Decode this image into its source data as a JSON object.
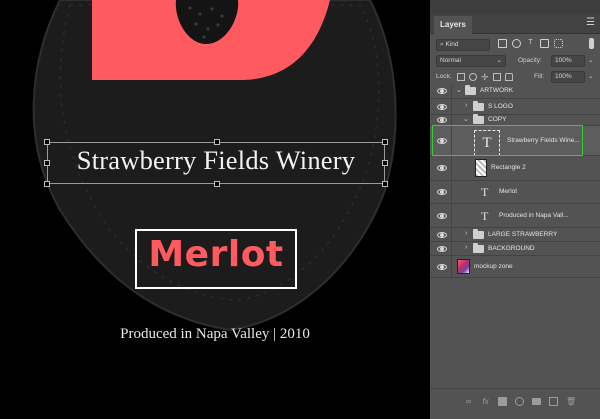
{
  "canvas": {
    "headline": "Strawberry Fields Winery",
    "wine_name": "Merlot",
    "produced": "Produced in Napa Valley | 2010"
  },
  "colors": {
    "accent": "#ff5a5f",
    "selection_outline": "#2fd02f",
    "panel_bg": "#535353"
  },
  "panel": {
    "tab_label": "Layers",
    "menu_icon": "hamburger-icon",
    "filter_kind": "Kind",
    "blend_mode": "Normal",
    "opacity_label": "Opacity:",
    "opacity_value": "100%",
    "lock_label": "Lock:",
    "fill_label": "Fill:",
    "fill_value": "100%",
    "layers": [
      {
        "name": "ARTWORK",
        "type": "group",
        "expanded": true
      },
      {
        "name": "S LOGO",
        "type": "group",
        "expanded": false
      },
      {
        "name": "COPY",
        "type": "group",
        "expanded": true
      },
      {
        "name": "Strawberry Fields Wine...",
        "type": "text",
        "selected": true
      },
      {
        "name": "Rectangle 2",
        "type": "shape"
      },
      {
        "name": "Merlot",
        "type": "text"
      },
      {
        "name": "Produced in Napa Vall...",
        "type": "text"
      },
      {
        "name": "LARGE STRAWBERRY",
        "type": "group",
        "expanded": false
      },
      {
        "name": "BACKGROUND",
        "type": "group",
        "expanded": false
      },
      {
        "name": "mockup zone",
        "type": "image"
      }
    ],
    "bottom_icons": [
      "link-icon",
      "fx-icon",
      "mask-icon",
      "adjustment-icon",
      "folder-icon",
      "new-layer-icon",
      "trash-icon"
    ]
  }
}
